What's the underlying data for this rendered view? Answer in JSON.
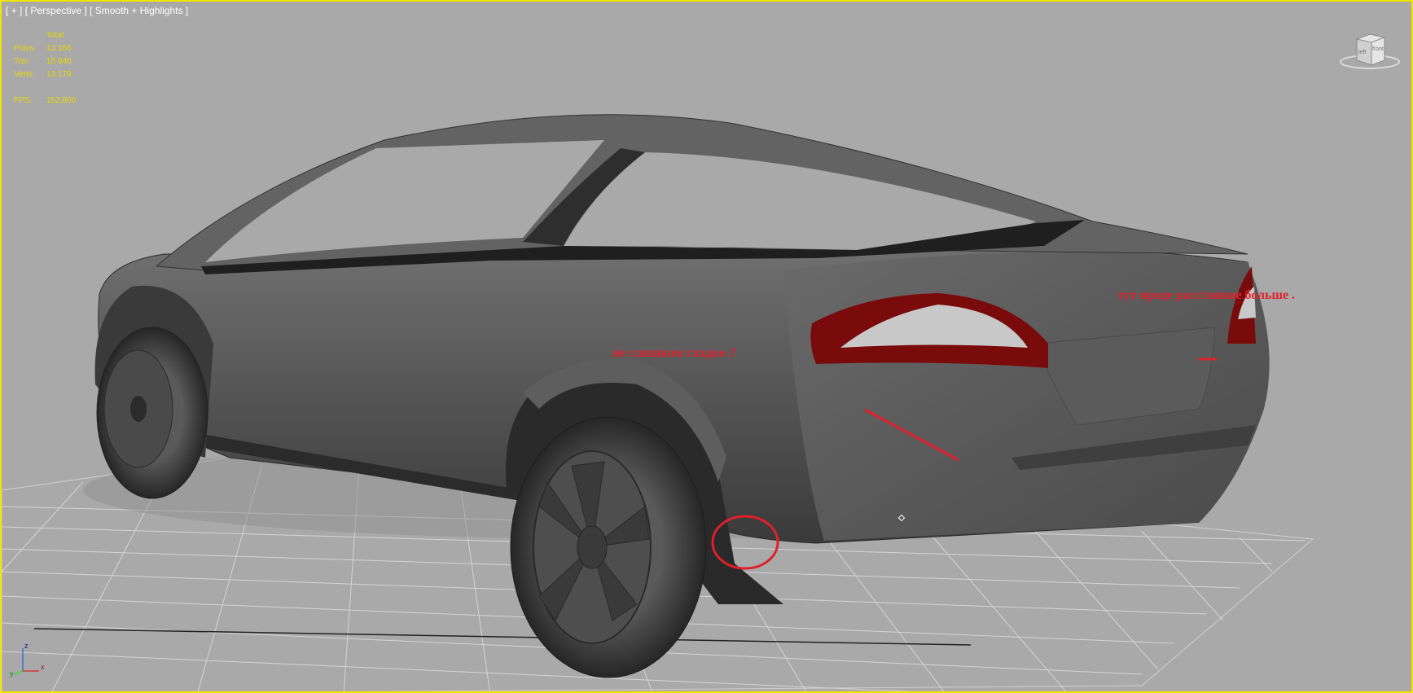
{
  "viewport": {
    "label_plus": "[ + ]",
    "label_view": "[ Perspective ]",
    "label_shading": "[ Smooth + Highlights ]"
  },
  "stats": {
    "header": "Total",
    "polys_label": "Polys:",
    "polys_value": "13 166",
    "tris_label": "Tris:",
    "tris_value": "15 940",
    "verts_label": "Verts:",
    "verts_value": "13 179",
    "fps_label": "FPS:",
    "fps_value": "152,800"
  },
  "viewcube": {
    "face_left": "left",
    "face_front": "front"
  },
  "annotations": {
    "note_smooth": "не слишком гладко ?",
    "note_distance": "тут вроде расстояние больше ."
  },
  "axis": {
    "z": "z",
    "x": "x",
    "y": "y"
  },
  "colors": {
    "viewport_border": "#f2e600",
    "stats_text": "#e8d800",
    "annotation": "#e0202a",
    "background": "#a9a9a9"
  }
}
